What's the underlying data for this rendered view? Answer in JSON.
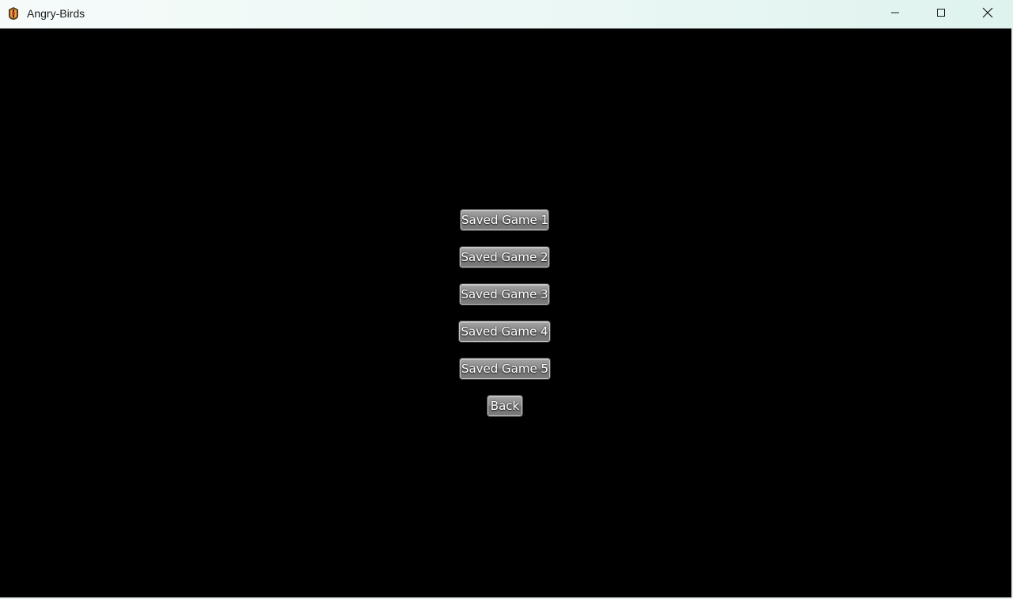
{
  "window": {
    "title": "Angry-Birds",
    "icon": "angry-birds-app-icon",
    "controls": {
      "minimize_icon": "minimize-icon",
      "maximize_icon": "maximize-icon",
      "close_icon": "close-icon"
    }
  },
  "menu": {
    "saved_games": [
      {
        "label": "Saved Game 1"
      },
      {
        "label": "Saved Game 2"
      },
      {
        "label": "Saved Game 3"
      },
      {
        "label": "Saved Game 4"
      },
      {
        "label": "Saved Game 5"
      }
    ],
    "back_label": "Back"
  },
  "colors": {
    "background": "#000000",
    "button_face": "#8a8a8a",
    "button_text": "#ffffff"
  }
}
